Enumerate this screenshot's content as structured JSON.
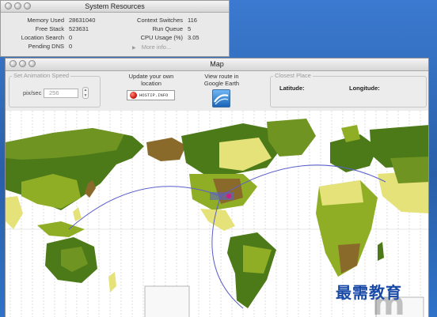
{
  "system_resources": {
    "title": "System Resources",
    "left_stats": [
      {
        "label": "Memory Used",
        "value": "28631040"
      },
      {
        "label": "Free Stack",
        "value": "523631"
      },
      {
        "label": "Location Search",
        "value": "0"
      },
      {
        "label": "Pending DNS",
        "value": "0"
      }
    ],
    "right_stats": [
      {
        "label": "Context Switches",
        "value": "116"
      },
      {
        "label": "Run Queue",
        "value": "5"
      },
      {
        "label": "CPU Usage (%)",
        "value": "3.05"
      }
    ],
    "more_info": "More info..."
  },
  "map_window": {
    "title": "Map",
    "speed": {
      "group_title": "Set Animation Speed",
      "unit_label": "pix/sec",
      "value": "256"
    },
    "update_location": {
      "label_line1": "Update your own",
      "label_line2": "location",
      "button_label": "HOSTIP.INFO"
    },
    "route": {
      "label_line1": "View route in",
      "label_line2": "Google Earth",
      "icon": "google-earth-icon"
    },
    "closest_place": {
      "group_title": "Closest Place",
      "latitude_label": "Latitude:",
      "longitude_label": "Longitude:"
    }
  },
  "watermark": {
    "text": "最需教育",
    "logo_text": "m"
  },
  "colors": {
    "desktop": "#2f6cbf",
    "land_dark": "#4d7a18",
    "land_mid": "#8fae25",
    "land_light": "#e6e27a",
    "land_brown": "#8a6a2a",
    "ocean": "#ffffff",
    "route_line": "#5a5fc8"
  }
}
